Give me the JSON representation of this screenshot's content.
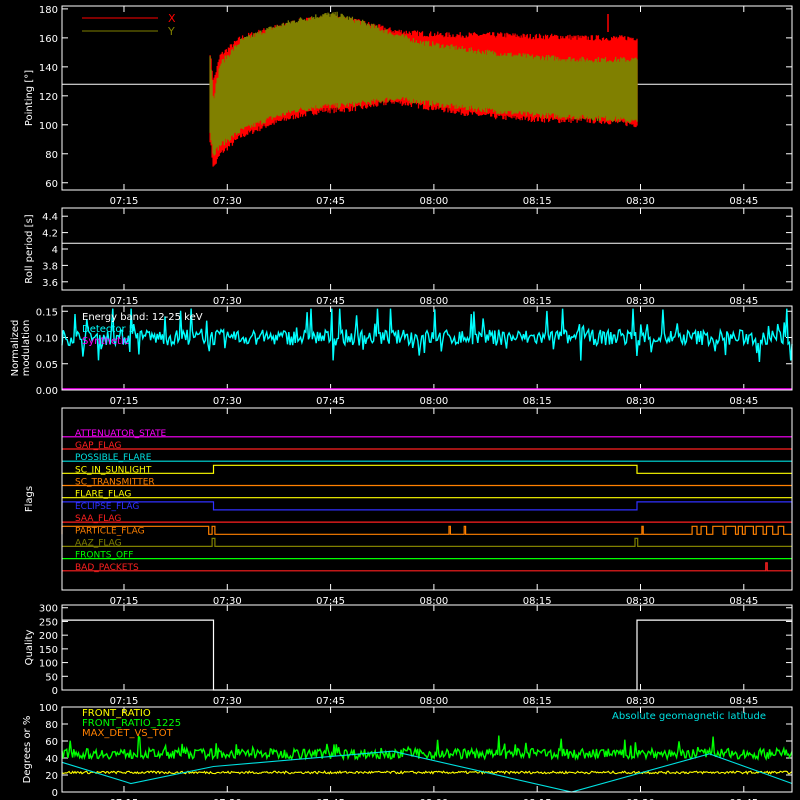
{
  "time_axis": {
    "tick_labels": [
      "07:15",
      "07:30",
      "07:45",
      "08:00",
      "08:15",
      "08:30",
      "08:45"
    ],
    "tick_minutes": [
      435,
      450,
      465,
      480,
      495,
      510,
      525
    ],
    "range_minutes": [
      426,
      532
    ]
  },
  "chart_data": [
    {
      "type": "area",
      "ylabel": "Pointing [°]",
      "ylim": [
        55,
        182
      ],
      "yticks": [
        60,
        80,
        100,
        120,
        140,
        160,
        180
      ],
      "reference_line": 128,
      "legend_placement": "top-left",
      "series": [
        {
          "name": "X",
          "color": "#ff0000",
          "x": [
            447.5,
            448,
            449,
            452,
            456,
            460,
            464,
            466,
            470,
            474,
            478,
            482,
            486,
            490,
            494,
            498,
            502,
            506,
            509.5
          ],
          "upper": [
            150,
            130,
            148,
            160,
            166,
            171,
            174,
            174,
            170,
            165,
            163,
            162,
            162,
            162,
            161,
            161,
            160,
            160,
            160
          ],
          "lower": [
            90,
            70,
            80,
            92,
            100,
            106,
            110,
            110,
            112,
            116,
            113,
            110,
            107,
            105,
            104,
            103,
            103,
            102,
            100
          ]
        },
        {
          "name": "Y",
          "color": "#808000",
          "x": [
            447.5,
            448,
            449,
            452,
            456,
            460,
            464,
            466,
            470,
            474,
            478,
            482,
            486,
            490,
            494,
            498,
            502,
            506,
            509.5
          ],
          "upper": [
            148,
            118,
            142,
            158,
            166,
            172,
            176,
            176,
            170,
            163,
            157,
            154,
            151,
            149,
            147,
            146,
            145,
            145,
            145
          ],
          "lower": [
            95,
            80,
            86,
            96,
            104,
            110,
            113,
            113,
            115,
            118,
            116,
            113,
            111,
            109,
            107,
            106,
            105,
            104,
            102
          ]
        }
      ]
    },
    {
      "type": "line",
      "ylabel": "Roll period [s]",
      "ylim": [
        3.5,
        4.5
      ],
      "yticks": [
        3.6,
        3.8,
        4.0,
        4.2,
        4.4
      ],
      "series": [
        {
          "color": "#ffffff",
          "x": [
            426,
            532
          ],
          "y": [
            4.07,
            4.07
          ]
        }
      ]
    },
    {
      "type": "line",
      "ylabel": "Normalized modulation",
      "ylim": [
        0.0,
        0.16
      ],
      "yticks": [
        0.0,
        0.05,
        0.1,
        0.15
      ],
      "tick_labels": [
        "0.00",
        "0.05",
        "0.10",
        "0.15"
      ],
      "annotations": [
        {
          "text": "Energy band: 12-25 keV",
          "color": "#ffffff"
        },
        {
          "text": "Detector 5",
          "color": "#00ffff"
        },
        {
          "text": "Synthetic",
          "color": "#ff00ff"
        }
      ],
      "series": [
        {
          "name": "Detector 5",
          "color": "#00ffff",
          "x_range": [
            426,
            532
          ],
          "mean": 0.1,
          "noise": 0.015,
          "spike_max": 0.155
        },
        {
          "name": "Synthetic",
          "color": "#ff00ff",
          "x": [
            426,
            532
          ],
          "y": [
            0.0,
            0.0
          ]
        }
      ]
    },
    {
      "type": "line",
      "ylabel": "Flags",
      "series": [
        {
          "name": "ATTENUATOR_STATE",
          "color": "#ff00ff",
          "segments": []
        },
        {
          "name": "GAP_FLAG",
          "color": "#ff2020",
          "segments": []
        },
        {
          "name": "POSSIBLE_FLARE",
          "color": "#00e0e0",
          "segments": []
        },
        {
          "name": "SC_IN_SUNLIGHT",
          "color": "#ffff00",
          "segments": [
            [
              448,
              509.5
            ]
          ]
        },
        {
          "name": "SC_TRANSMITTER",
          "color": "#ff8000",
          "segments": []
        },
        {
          "name": "FLARE_FLAG",
          "color": "#ffff00",
          "segments": []
        },
        {
          "name": "ECLIPSE_FLAG",
          "color": "#3030ff",
          "segments": [
            [
              426,
              448
            ],
            [
              509.5,
              532
            ]
          ]
        },
        {
          "name": "SAA_FLAG",
          "color": "#ff2020",
          "segments": []
        },
        {
          "name": "PARTICLE_FLAG",
          "color": "#ff8000",
          "segments": [
            [
              426,
              447.3
            ],
            [
              447.8,
              448.2
            ],
            [
              482.2,
              482.4
            ],
            [
              484.4,
              484.6
            ],
            [
              510.2,
              510.4
            ],
            [
              517.5,
              518.2
            ],
            [
              518.8,
              519.6
            ],
            [
              520.5,
              522.0
            ],
            [
              522.4,
              523.8
            ],
            [
              524.2,
              524.8
            ],
            [
              525.2,
              526.4
            ],
            [
              526.8,
              527.8
            ],
            [
              528.3,
              529.2
            ],
            [
              530.0,
              530.8
            ]
          ]
        },
        {
          "name": "AAZ_FLAG",
          "color": "#808000",
          "segments": [
            [
              447.8,
              448.2
            ],
            [
              509.2,
              509.6
            ]
          ]
        },
        {
          "name": "FRONTS_OFF",
          "color": "#00ff00",
          "segments": []
        },
        {
          "name": "BAD_PACKETS",
          "color": "#ff2020",
          "segments": [
            [
              528.2,
              528.4
            ]
          ]
        }
      ]
    },
    {
      "type": "line",
      "ylabel": "Quality",
      "ylim": [
        0,
        310
      ],
      "yticks": [
        0,
        50,
        100,
        150,
        200,
        250,
        300
      ],
      "series": [
        {
          "color": "#ffffff",
          "x": [
            426,
            448,
            448,
            509.5,
            509.5,
            532
          ],
          "y": [
            255,
            255,
            0,
            0,
            255,
            255
          ]
        }
      ]
    },
    {
      "type": "line",
      "ylabel": "Degrees or %",
      "ylim": [
        0,
        100
      ],
      "yticks": [
        0,
        20,
        40,
        60,
        80,
        100
      ],
      "series": [
        {
          "name": "FRONT_RATIO",
          "color": "#ffff00",
          "x_range": [
            426,
            532
          ],
          "mean": 23,
          "noise": 1.5
        },
        {
          "name": "FRONT_RATIO_1225",
          "color": "#00ff00",
          "x_range": [
            426,
            532
          ],
          "mean": 45,
          "noise": 6
        },
        {
          "name": "MAX_DET_VS_TOT",
          "color": "#ff8000",
          "x": [
            426,
            532
          ],
          "y": [
            0,
            0
          ]
        },
        {
          "name": "Absolute geomagnetic latitude",
          "color": "#00e0e0",
          "x": [
            426,
            436,
            448,
            474,
            500,
            520,
            532
          ],
          "y": [
            35,
            10,
            30,
            48,
            0,
            45,
            10
          ]
        }
      ]
    }
  ]
}
